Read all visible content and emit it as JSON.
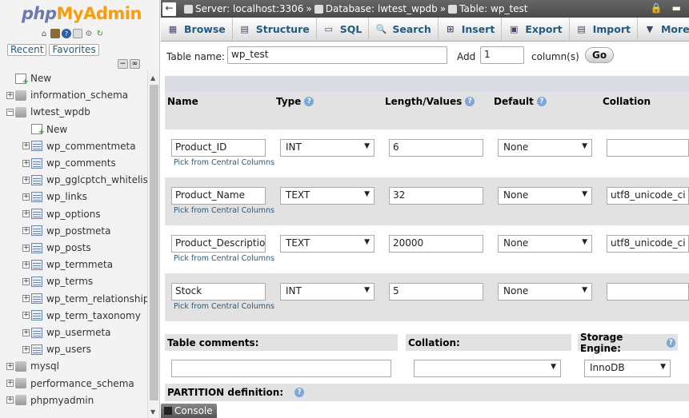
{
  "app": {
    "logo_php": "php",
    "logo_my": "My",
    "logo_admin": "Admin"
  },
  "nav": {
    "tabs": [
      "Recent",
      "Favorites"
    ],
    "tree": [
      {
        "label": "New",
        "type": "new",
        "depth": 0
      },
      {
        "label": "information_schema",
        "type": "db",
        "depth": 0,
        "exp": "+"
      },
      {
        "label": "lwtest_wpdb",
        "type": "db",
        "depth": 0,
        "exp": "−"
      },
      {
        "label": "New",
        "type": "new",
        "depth": 1
      },
      {
        "label": "wp_commentmeta",
        "type": "tbl",
        "depth": 1,
        "exp": "+"
      },
      {
        "label": "wp_comments",
        "type": "tbl",
        "depth": 1,
        "exp": "+"
      },
      {
        "label": "wp_gglcptch_whitelist",
        "type": "tbl",
        "depth": 1,
        "exp": "+"
      },
      {
        "label": "wp_links",
        "type": "tbl",
        "depth": 1,
        "exp": "+"
      },
      {
        "label": "wp_options",
        "type": "tbl",
        "depth": 1,
        "exp": "+"
      },
      {
        "label": "wp_postmeta",
        "type": "tbl",
        "depth": 1,
        "exp": "+"
      },
      {
        "label": "wp_posts",
        "type": "tbl",
        "depth": 1,
        "exp": "+"
      },
      {
        "label": "wp_termmeta",
        "type": "tbl",
        "depth": 1,
        "exp": "+"
      },
      {
        "label": "wp_terms",
        "type": "tbl",
        "depth": 1,
        "exp": "+"
      },
      {
        "label": "wp_term_relationships",
        "type": "tbl",
        "depth": 1,
        "exp": "+"
      },
      {
        "label": "wp_term_taxonomy",
        "type": "tbl",
        "depth": 1,
        "exp": "+"
      },
      {
        "label": "wp_usermeta",
        "type": "tbl",
        "depth": 1,
        "exp": "+"
      },
      {
        "label": "wp_users",
        "type": "tbl",
        "depth": 1,
        "exp": "+"
      },
      {
        "label": "mysql",
        "type": "db",
        "depth": 0,
        "exp": "+"
      },
      {
        "label": "performance_schema",
        "type": "db",
        "depth": 0,
        "exp": "+"
      },
      {
        "label": "phpmyadmin",
        "type": "db",
        "depth": 0,
        "exp": "+"
      }
    ]
  },
  "breadcrumb": {
    "server": "Server: localhost:3306",
    "database": "Database: lwtest_wpdb",
    "table": "Table: wp_test",
    "separator": "»"
  },
  "menu": [
    {
      "label": "Browse",
      "icon": "browse-icon"
    },
    {
      "label": "Structure",
      "icon": "structure-icon"
    },
    {
      "label": "SQL",
      "icon": "sql-icon"
    },
    {
      "label": "Search",
      "icon": "search-icon"
    },
    {
      "label": "Insert",
      "icon": "insert-icon"
    },
    {
      "label": "Export",
      "icon": "export-icon"
    },
    {
      "label": "Import",
      "icon": "import-icon"
    },
    {
      "label": "More",
      "icon": "chevron-down-icon"
    }
  ],
  "form": {
    "table_name_label": "Table name:",
    "table_name_value": "wp_test",
    "add_label": "Add",
    "add_count": "1",
    "columns_label": "column(s)",
    "go_label": "Go"
  },
  "headers": {
    "name": "Name",
    "type": "Type",
    "length": "Length/Values",
    "default": "Default",
    "collation": "Collation"
  },
  "pick_label": "Pick from Central Columns",
  "rows": [
    {
      "name": "Product_ID",
      "type": "INT",
      "length": "6",
      "default": "None",
      "collation": ""
    },
    {
      "name": "Product_Name",
      "type": "TEXT",
      "length": "32",
      "default": "None",
      "collation": "utf8_unicode_ci"
    },
    {
      "name": "Product_Description",
      "type": "TEXT",
      "length": "20000",
      "default": "None",
      "collation": "utf8_unicode_ci"
    },
    {
      "name": "Stock",
      "type": "INT",
      "length": "5",
      "default": "None",
      "collation": ""
    }
  ],
  "bottom": {
    "table_comments_label": "Table comments:",
    "collation_label": "Collation:",
    "storage_engine_label": "Storage Engine:",
    "storage_engine_value": "InnoDB",
    "partition_label": "PARTITION definition:",
    "console_label": "Console"
  }
}
